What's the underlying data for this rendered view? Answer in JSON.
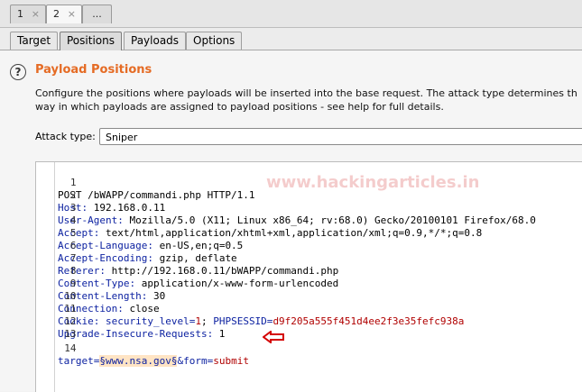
{
  "request_tabs": [
    {
      "label": "1",
      "close": "×"
    },
    {
      "label": "2",
      "close": "×"
    },
    {
      "label": "..."
    }
  ],
  "sub_tabs": [
    "Target",
    "Positions",
    "Payloads",
    "Options"
  ],
  "section": {
    "help_icon": "?",
    "title": "Payload Positions",
    "description_line1": "Configure the positions where payloads will be inserted into the base request. The attack type determines th",
    "description_line2": "way in which payloads are assigned to payload positions - see help for full details."
  },
  "attack_type": {
    "label": "Attack type:",
    "value": "Sniper"
  },
  "watermark": "www.hackingarticles.in",
  "request_lines": [
    {
      "n": "1",
      "plain": "POST /bWAPP/commandi.php HTTP/1.1"
    },
    {
      "n": "2",
      "key": "Host:",
      "rest": " 192.168.0.11"
    },
    {
      "n": "3",
      "key": "User-Agent:",
      "rest": " Mozilla/5.0 (X11; Linux x86_64; rv:68.0) Gecko/20100101 Firefox/68.0"
    },
    {
      "n": "4",
      "key": "Accept:",
      "rest": " text/html,application/xhtml+xml,application/xml;q=0.9,*/*;q=0.8"
    },
    {
      "n": "5",
      "key": "Accept-Language:",
      "rest": " en-US,en;q=0.5"
    },
    {
      "n": "6",
      "key": "Accept-Encoding:",
      "rest": " gzip, deflate"
    },
    {
      "n": "7",
      "key": "Referer:",
      "rest": " http://192.168.0.11/bWAPP/commandi.php"
    },
    {
      "n": "8",
      "key": "Content-Type:",
      "rest": " application/x-www-form-urlencoded"
    },
    {
      "n": "9",
      "key": "Content-Length:",
      "rest": " 30"
    },
    {
      "n": "10",
      "key": "Connection:",
      "rest": " close"
    },
    {
      "n": "11",
      "key": "Cookie:",
      "cookie1_name": " security_level=",
      "cookie1_val": "1",
      "sep": "; ",
      "cookie2_name": "PHPSESSID=",
      "cookie2_val": "d9f205a555f451d4ee2f3e35fefc938a"
    },
    {
      "n": "12",
      "key": "Upgrade-Insecure-Requests:",
      "rest": " 1"
    },
    {
      "n": "13",
      "plain": ""
    },
    {
      "n": "14",
      "p1": "target=",
      "pos": "§www.nsa.gov§",
      "p2": "&form=",
      "p3": "submit"
    }
  ],
  "colors": {
    "title": "#e56b24",
    "key": "#0d22a1",
    "value_red": "#b00000",
    "arrow": "#d40000"
  }
}
